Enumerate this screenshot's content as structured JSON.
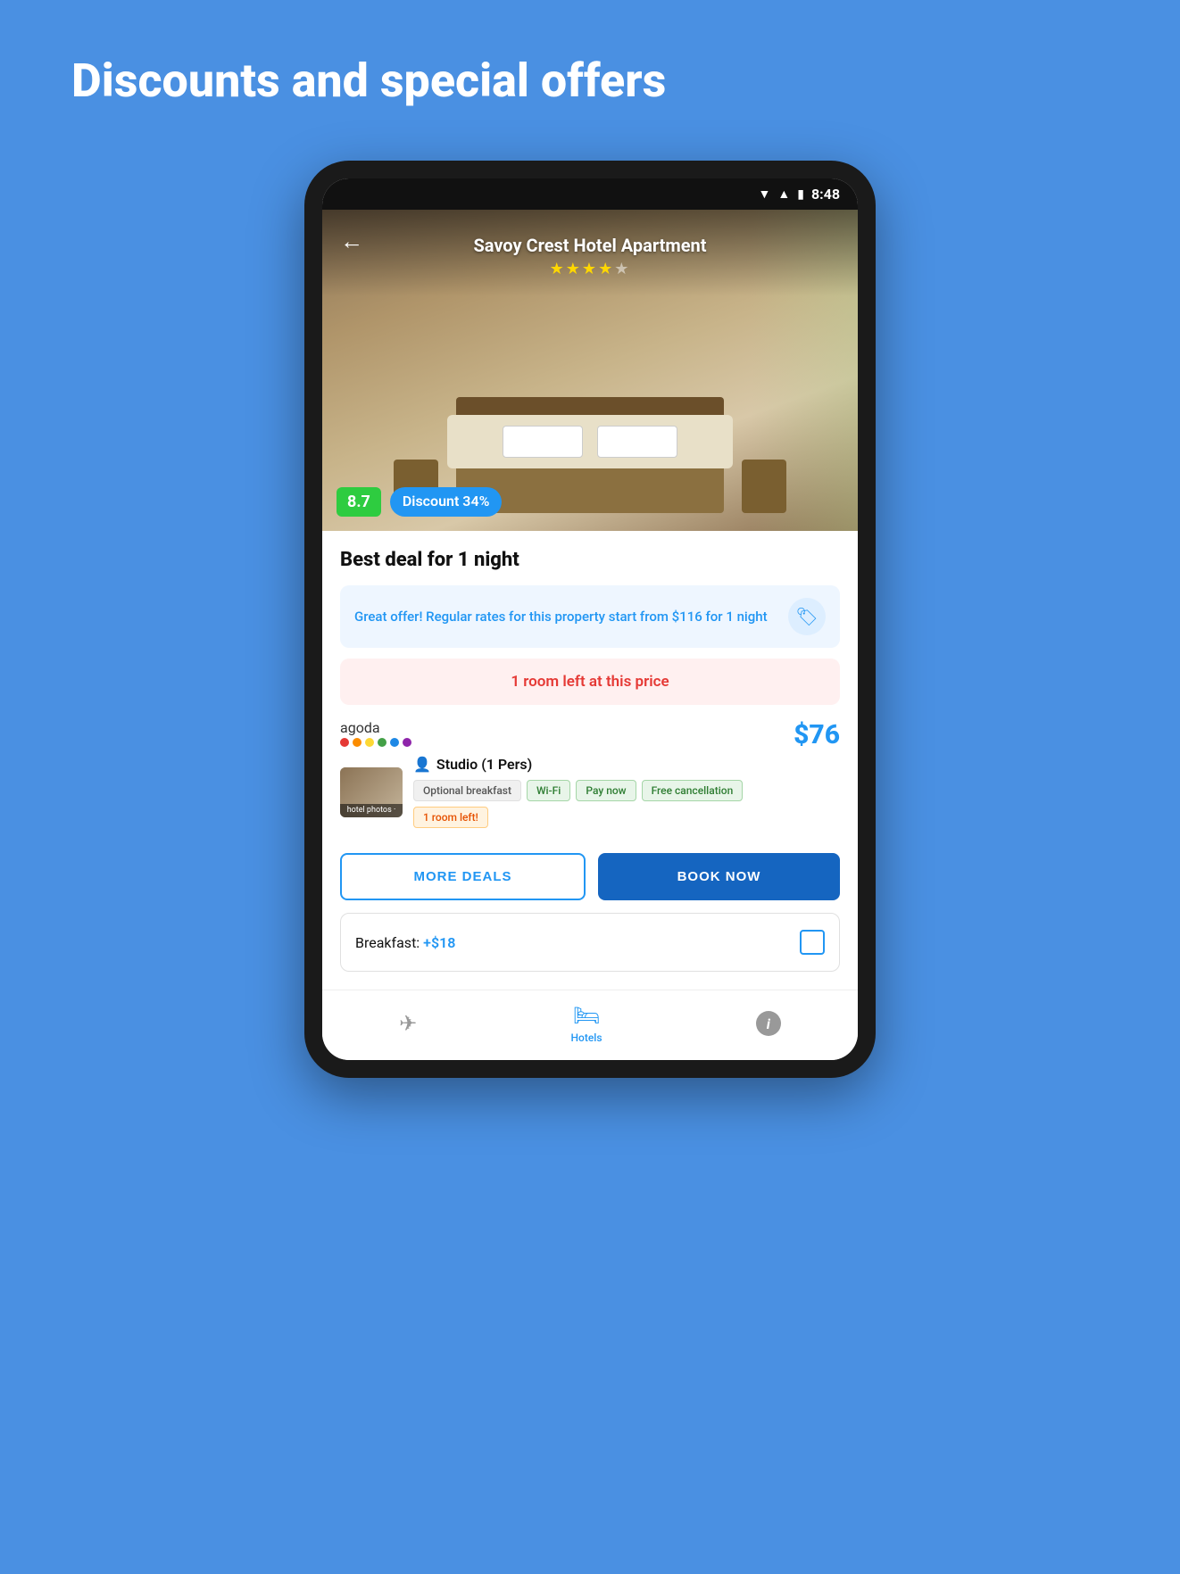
{
  "page": {
    "background_color": "#4A90E2",
    "title": "Discounts and special offers"
  },
  "status_bar": {
    "time": "8:48"
  },
  "hotel": {
    "name": "Savoy Crest Hotel Apartment",
    "stars": 4.5,
    "score": "8.7",
    "discount_badge": "Discount 34%"
  },
  "deal": {
    "title": "Best deal for 1 night",
    "offer_text": "Great offer! Regular rates for this property start from $116 for 1 night",
    "rooms_left_text": "1 room left at this price"
  },
  "booking": {
    "provider": "agoda",
    "price": "$76",
    "room_type": "Studio (1 Pers)",
    "photo_label": "hotel photos ·",
    "amenities": [
      {
        "label": "Optional breakfast",
        "type": "gray"
      },
      {
        "label": "Wi-Fi",
        "type": "green"
      },
      {
        "label": "Pay now",
        "type": "green"
      },
      {
        "label": "Free cancellation",
        "type": "green"
      },
      {
        "label": "1 room left!",
        "type": "orange"
      }
    ]
  },
  "buttons": {
    "more_deals": "MORE DEALS",
    "book_now": "BOOK NOW"
  },
  "breakfast": {
    "label": "Breakfast:",
    "price": "+$18"
  },
  "bottom_nav": {
    "items": [
      {
        "label": "",
        "icon": "✈"
      },
      {
        "label": "Hotels",
        "icon": "🛏"
      },
      {
        "label": "",
        "icon": "ℹ"
      }
    ]
  }
}
